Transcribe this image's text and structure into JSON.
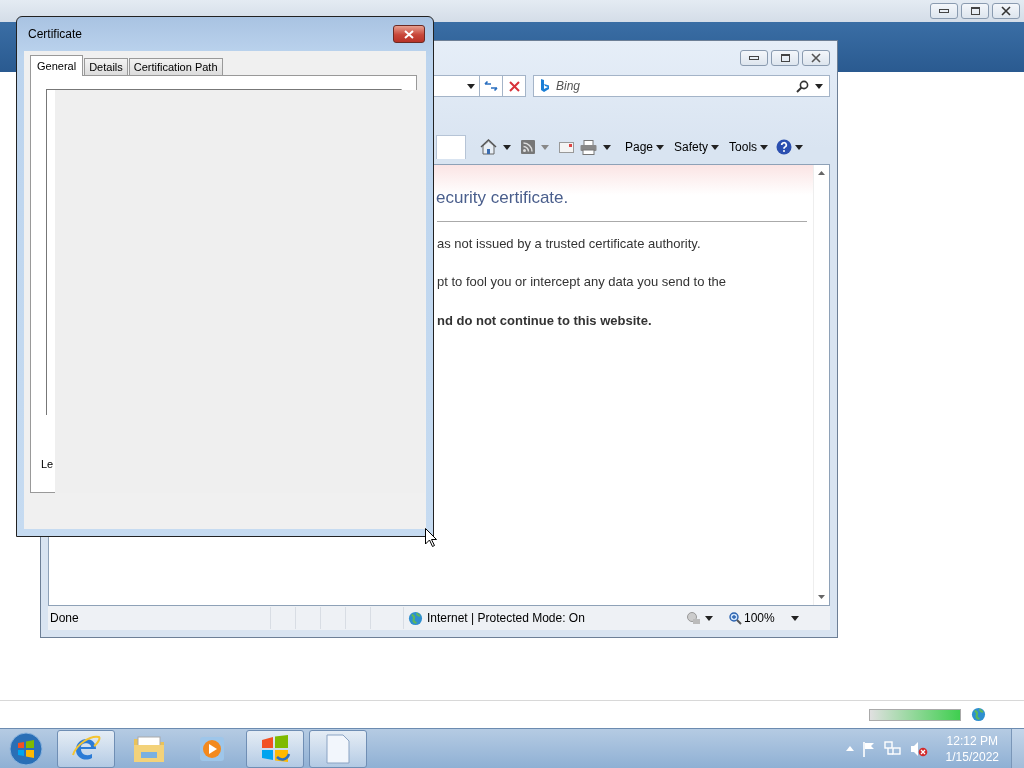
{
  "desktop_window": {
    "progress": {
      "level": 1
    }
  },
  "browser": {
    "search": {
      "placeholder": "Bing"
    },
    "command_bar": [
      {
        "label": "Page"
      },
      {
        "label": "Safety"
      },
      {
        "label": "Tools"
      }
    ],
    "heading": "ecurity certificate.",
    "paragraphs": [
      {
        "text": "as not issued by a trusted certificate authority.",
        "bold": false
      },
      {
        "text": "pt to fool you or intercept any data you send to the",
        "bold": false
      },
      {
        "text": "nd do not continue to this website.",
        "bold": true
      }
    ],
    "status_bar": {
      "status": "Done",
      "zone": "Internet | Protected Mode: On",
      "zoom": "100%"
    }
  },
  "certificate_dialog": {
    "title": "Certificate",
    "tabs": [
      {
        "label": "General",
        "selected": true
      },
      {
        "label": "Details",
        "selected": false
      },
      {
        "label": "Certification Path",
        "selected": false
      }
    ],
    "panel_text": "Le"
  },
  "taskbar": {
    "apps": [
      {
        "kind": "browser",
        "open": true
      },
      {
        "kind": "folder",
        "open": false
      },
      {
        "kind": "media",
        "open": false
      },
      {
        "kind": "windows",
        "open": true
      },
      {
        "kind": "document",
        "open": true
      }
    ],
    "time": "12:12 PM",
    "date": "1/15/2022"
  }
}
